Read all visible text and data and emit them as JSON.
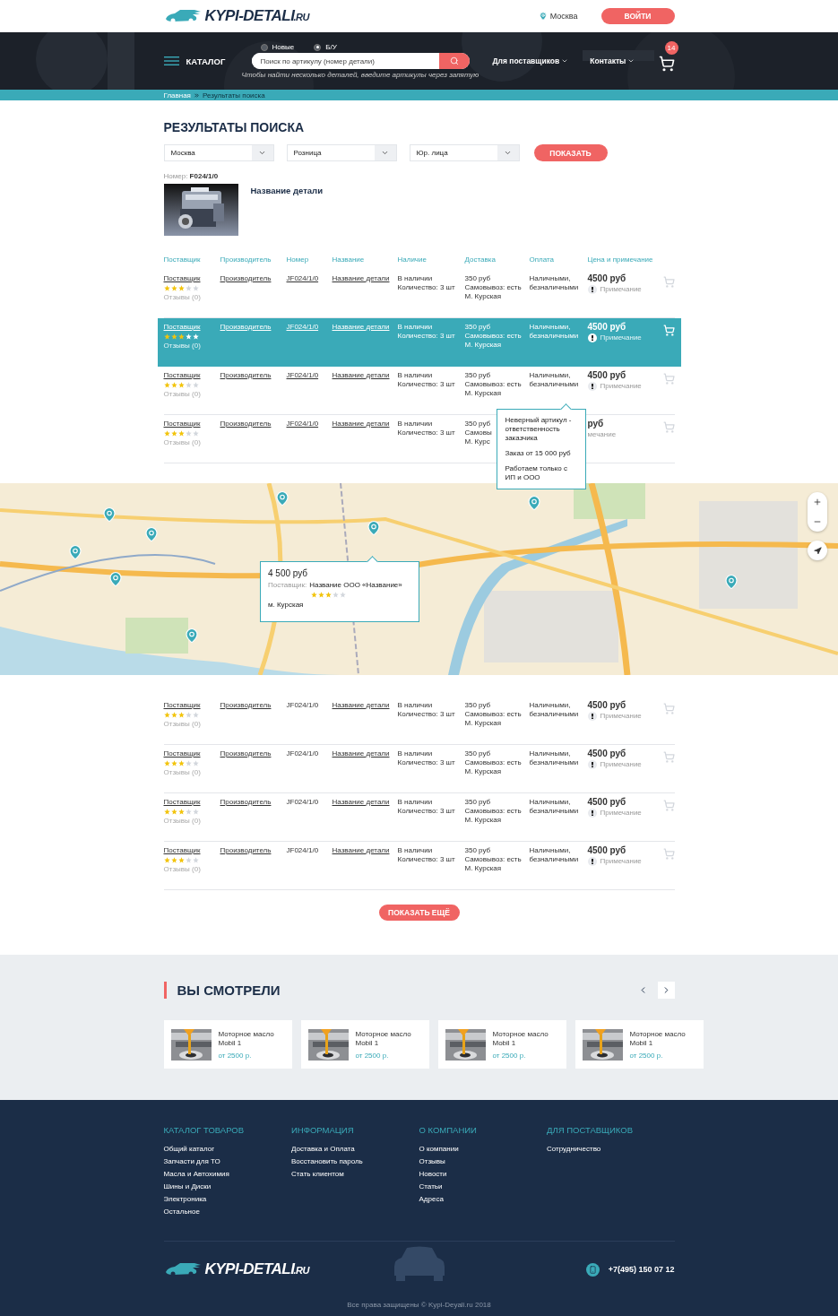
{
  "header": {
    "logo": {
      "name": "KYPI-DETALI",
      "suffix": ".RU"
    },
    "city": "Москва",
    "login": "ВОЙТИ"
  },
  "nav": {
    "conditions": [
      {
        "label": "Новые",
        "selected": false
      },
      {
        "label": "Б/У",
        "selected": true
      }
    ],
    "catalog": "КАТАЛОГ",
    "search": {
      "placeholder": "Поиск по артикулу (номер детали)"
    },
    "hint": "Чтобы найти несколько деталей, введите артикулы через запятую",
    "menu": [
      "Для поставщиков",
      "Контакты"
    ],
    "cart_count": "14"
  },
  "breadcrumbs": [
    "Главная",
    "Результаты поиска"
  ],
  "title": "РЕЗУЛЬТАТЫ ПОИСКА",
  "filters": [
    {
      "value": "Москва"
    },
    {
      "value": "Розница"
    },
    {
      "value": "Юр. лица"
    }
  ],
  "show_button": "ПОКАЗАТЬ",
  "part": {
    "number_label": "Номер:",
    "number": "F024/1/0",
    "name": "Название детали"
  },
  "columns": [
    "Поставщик",
    "Производитель",
    "Номер",
    "Название",
    "Наличие",
    "Доставка",
    "Оплата",
    "Цена и примечание"
  ],
  "rows": [
    {
      "kind": "full",
      "selected": false,
      "supplier": "Поставщик",
      "stars": 3,
      "reviews": "Отзывы (0)",
      "producer": "Производитель",
      "number": "JF024/1/0",
      "number_underlined": true,
      "name": "Название детали",
      "availability": [
        "В наличии",
        "Количество: 3 шт"
      ],
      "delivery": [
        "350 руб",
        "Самовывоз: есть",
        "М. Курская"
      ],
      "payment": [
        "Наличными,",
        "безналичными"
      ],
      "price": "4500 руб",
      "note": "Примечание"
    },
    {
      "kind": "full",
      "selected": true,
      "supplier": "Поставщик",
      "stars": 3,
      "reviews": "Отзывы (0)",
      "producer": "Производитель",
      "number": "JF024/1/0",
      "number_underlined": true,
      "name": "Название детали",
      "availability": [
        "В наличии",
        "Количество: 3 шт"
      ],
      "delivery": [
        "350 руб",
        "Самовывоз: есть",
        "М. Курская"
      ],
      "payment": [
        "Наличными,",
        "безналичными"
      ],
      "price": "4500 руб",
      "note": "Примечание"
    },
    {
      "kind": "full",
      "selected": false,
      "supplier": "Поставщик",
      "stars": 3,
      "reviews": "Отзывы (0)",
      "producer": "Производитель",
      "number": "JF024/1/0",
      "number_underlined": true,
      "name": "Название детали",
      "availability": [
        "В наличии",
        "Количество: 3 шт"
      ],
      "delivery": [
        "350 руб",
        "Самовывоз: есть",
        "М. Курская"
      ],
      "payment": [
        "Наличными,",
        "безналичными"
      ],
      "price": "4500 руб",
      "note": "Примечание",
      "tooltip": [
        "Неверный артикул - ответственность заказчика",
        "Заказ от 15 000 руб",
        "Работаем только с ИП и ООО"
      ]
    },
    {
      "kind": "covered",
      "selected": false,
      "supplier": "Поставщик",
      "stars": 3,
      "reviews": "Отзывы (0)",
      "producer": "Производитель",
      "number": "JF024/1/0",
      "number_underlined": true,
      "name": "Название детали",
      "availability": [
        "В наличии",
        "Количество: 3 шт"
      ],
      "delivery": [
        "350 руб",
        "Самовы",
        "М. Курс"
      ],
      "payment": [],
      "price": "руб",
      "note": "мечание"
    }
  ],
  "map": {
    "popup": {
      "price": "4 500 руб",
      "supplier_label": "Поставщик:",
      "supplier": "Название ООО «Название»",
      "stars": 3,
      "metro": "м. Курская"
    }
  },
  "rows_below": [
    {
      "kind": "full",
      "selected": false,
      "supplier": "Поставщик",
      "stars": 3,
      "reviews": "Отзывы (0)",
      "producer": "Производитель",
      "number": "JF024/1/0",
      "number_underlined": false,
      "name": "Название детали",
      "availability": [
        "В наличии",
        "Количество: 3 шт"
      ],
      "delivery": [
        "350 руб",
        "Самовывоз: есть",
        "М. Курская"
      ],
      "payment": [
        "Наличными,",
        "безналичными"
      ],
      "price": "4500 руб",
      "note": "Примечание"
    },
    {
      "kind": "full",
      "selected": false,
      "supplier": "Поставщик",
      "stars": 3,
      "reviews": "Отзывы (0)",
      "producer": "Производитель",
      "number": "JF024/1/0",
      "number_underlined": false,
      "name": "Название детали",
      "availability": [
        "В наличии",
        "Количество: 3 шт"
      ],
      "delivery": [
        "350 руб",
        "Самовывоз: есть",
        "М. Курская"
      ],
      "payment": [
        "Наличными,",
        "безналичными"
      ],
      "price": "4500 руб",
      "note": "Примечание"
    },
    {
      "kind": "full",
      "selected": false,
      "supplier": "Поставщик",
      "stars": 3,
      "reviews": "Отзывы (0)",
      "producer": "Производитель",
      "number": "JF024/1/0",
      "number_underlined": false,
      "name": "Название детали",
      "availability": [
        "В наличии",
        "Количество: 3 шт"
      ],
      "delivery": [
        "350 руб",
        "Самовывоз: есть",
        "М. Курская"
      ],
      "payment": [
        "Наличными,",
        "безналичными"
      ],
      "price": "4500 руб",
      "note": "Примечание"
    },
    {
      "kind": "full",
      "selected": false,
      "supplier": "Поставщик",
      "stars": 3,
      "reviews": "Отзывы (0)",
      "producer": "Производитель",
      "number": "JF024/1/0",
      "number_underlined": false,
      "name": "Название детали",
      "availability": [
        "В наличии",
        "Количество: 3 шт"
      ],
      "delivery": [
        "350 руб",
        "Самовывоз: есть",
        "М. Курская"
      ],
      "payment": [
        "Наличными,",
        "безналичными"
      ],
      "price": "4500 руб",
      "note": "Примечание"
    }
  ],
  "more_button": "ПОКАЗАТЬ ЕЩЁ",
  "viewed": {
    "title": "ВЫ СМОТРЕЛИ",
    "arrows": [
      {
        "kind": "prev",
        "selected": false
      },
      {
        "kind": "next",
        "selected": true
      }
    ],
    "items": [
      {
        "name": "Моторное масло Mobil 1",
        "price": "от 2500 р."
      },
      {
        "name": "Моторное масло Mobil 1",
        "price": "от 2500 р."
      },
      {
        "name": "Моторное масло Mobil 1",
        "price": "от 2500 р."
      },
      {
        "name": "Моторное масло Mobil 1",
        "price": "от 2500 р."
      }
    ]
  },
  "footer": {
    "columns": [
      {
        "title": "КАТАЛОГ ТОВАРОВ",
        "links": [
          "Общий каталог",
          "Запчасти для ТО",
          "Масла и Автохимия",
          "Шины и Диски",
          "Электроника",
          "Остальное"
        ]
      },
      {
        "title": "ИНФОРМАЦИЯ",
        "links": [
          "Доставка и Оплата",
          "Восстановить пароль",
          "Стать клиентом"
        ]
      },
      {
        "title": "О КОМПАНИИ",
        "links": [
          "О компании",
          "Отзывы",
          "Новости",
          "Статьи",
          "Адреса"
        ]
      },
      {
        "title": "ДЛЯ ПОСТАВЩИКОВ",
        "links": [
          "Сотрудничество"
        ]
      }
    ],
    "logo": {
      "name": "KYPI-DETALI",
      "suffix": ".RU"
    },
    "phone": "+7(495) 150 07 12",
    "copyright": "Все права защищены © Kypi-Deyali.ru 2018"
  }
}
